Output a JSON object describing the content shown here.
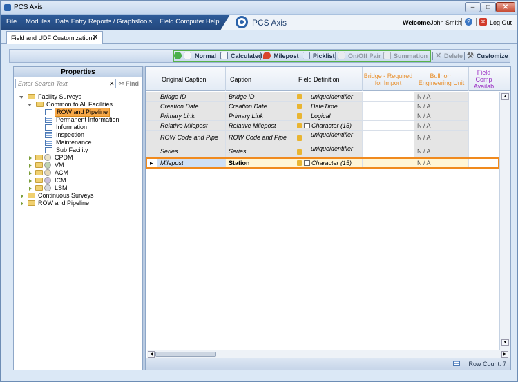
{
  "window": {
    "title": "PCS Axis"
  },
  "menu": [
    "File",
    "Modules",
    "Data Entry",
    "Reports / Graphs",
    "Tools",
    "Field Computer",
    "Help"
  ],
  "header": {
    "app_name": "PCS Axis",
    "welcome": "Welcome",
    "user": "John Smith",
    "logout": "Log Out"
  },
  "tabs": [
    {
      "label": "Field and UDF Customizations"
    }
  ],
  "toolbar": {
    "normal": "Normal",
    "calculated": "Calculated",
    "milepost": "Milepost",
    "picklist": "Picklist",
    "onoff": "On/Off Pair",
    "summation": "Summation",
    "delete": "Delete",
    "customize": "Customize"
  },
  "properties": {
    "title": "Properties",
    "search_placeholder": "Enter Search Text",
    "find": "Find",
    "tree": {
      "facility_surveys": "Facility Surveys",
      "common": "Common to All Facilities",
      "row_pipeline": "ROW and Pipeline",
      "permanent_info": "Permanent Information",
      "information": "Information",
      "inspection": "Inspection",
      "maintenance": "Maintenance",
      "sub_facility": "Sub Facility",
      "cpdm": "CPDM",
      "vm": "VM",
      "acm": "ACM",
      "icm": "ICM",
      "lsm": "LSM",
      "continuous": "Continuous Surveys",
      "row_pipeline_root": "ROW and Pipeline"
    }
  },
  "grid": {
    "columns": {
      "original_caption": "Original Caption",
      "caption": "Caption",
      "field_definition": "Field Definition",
      "bridge_required": "Bridge - Required for Import",
      "bullhorn": "Bullhorn Engineering Unit",
      "field_comp": "Field Comp Availab"
    },
    "rows": [
      {
        "original": "Bridge ID",
        "caption": "Bridge ID",
        "definition": "uniqueidentifier",
        "bullhorn": "N / A"
      },
      {
        "original": "Creation Date",
        "caption": "Creation Date",
        "definition": "DateTime",
        "bullhorn": "N / A"
      },
      {
        "original": "Primary Link",
        "caption": "Primary Link",
        "definition": "Logical",
        "bullhorn": "N / A"
      },
      {
        "original": "Relative Milepost",
        "caption": "Relative Milepost",
        "definition": "Character (15)",
        "bullhorn": "N / A"
      },
      {
        "original": "ROW Code and Pipe",
        "caption": "ROW Code and Pipe",
        "definition": "uniqueidentifier",
        "bullhorn": "N / A"
      },
      {
        "original": "Series",
        "caption": "Series",
        "definition": "uniqueidentifier",
        "bullhorn": "N / A"
      },
      {
        "original": "Milepost",
        "caption": "Station",
        "definition": "Character (15)",
        "bullhorn": "N / A"
      }
    ],
    "row_count_label": "Row Count: 7"
  },
  "colors": {
    "menubar": "#2e5c9a",
    "selection": "#f7a848",
    "toolbar_group_border": "#58b24a",
    "bridge_header": "#e8902e",
    "fieldcomp_header": "#9b2fc4"
  }
}
